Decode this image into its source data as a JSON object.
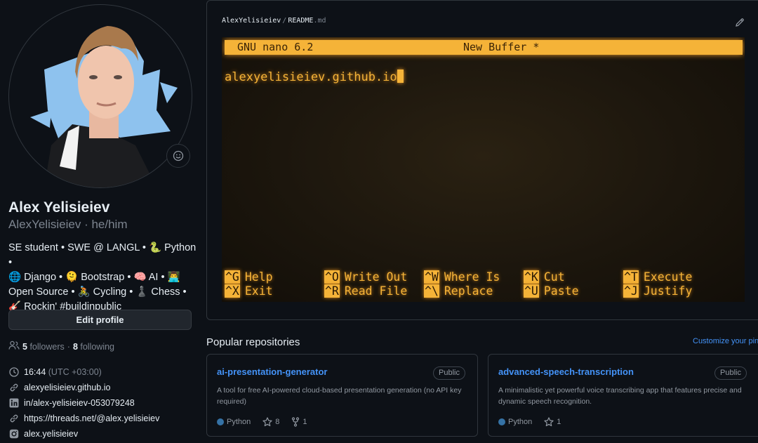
{
  "profile": {
    "name": "Alex Yelisieiev",
    "login": "AlexYelisieiev",
    "pronouns": "he/him",
    "bio_lines": [
      "SE student • SWE @ LANGL • 🐍 Python •",
      "🌐 Django • 🫠 Bootstrap • 🧠 AI • 👨‍💻",
      "Open Source • 🚴 Cycling • ♟️ Chess •",
      "🎸 Rockin' #buildinpublic"
    ],
    "edit_button": "Edit profile",
    "followers_count": "5",
    "followers_label": "followers",
    "dot": "·",
    "following_count": "8",
    "following_label": "following",
    "local_time": "16:44",
    "timezone": "(UTC +03:00)",
    "website": "alexyelisieiev.github.io",
    "linkedin": "in/alex-yelisieiev-053079248",
    "threads": "https://threads.net/@alex.yelisieiev",
    "instagram": "alex.yelisieiev"
  },
  "readme": {
    "owner": "AlexYelisieiev",
    "separator": "/",
    "file_name": "README",
    "file_ext": ".md",
    "terminal": {
      "title_left": "GNU nano 6.2",
      "title_mid": "New Buffer *",
      "content": "alexyelisieiev.github.io",
      "shortcuts": [
        {
          "key": "^G",
          "label": "Help"
        },
        {
          "key": "^O",
          "label": "Write Out"
        },
        {
          "key": "^W",
          "label": "Where Is"
        },
        {
          "key": "^K",
          "label": "Cut"
        },
        {
          "key": "^T",
          "label": "Execute"
        },
        {
          "key": "^X",
          "label": "Exit"
        },
        {
          "key": "^R",
          "label": "Read File"
        },
        {
          "key": "^\\",
          "label": "Replace"
        },
        {
          "key": "^U",
          "label": "Paste"
        },
        {
          "key": "^J",
          "label": "Justify"
        }
      ]
    }
  },
  "popular": {
    "title": "Popular repositories",
    "customize": "Customize your pins",
    "repos": [
      {
        "name": "ai-presentation-generator",
        "visibility": "Public",
        "description": "A tool for free AI-powered cloud-based presentation generation (no API key required)",
        "language": "Python",
        "language_color": "#3572A5",
        "stars": "8",
        "forks": "1"
      },
      {
        "name": "advanced-speech-transcription",
        "visibility": "Public",
        "description": "A minimalistic yet powerful voice transcribing app that features precise and dynamic speech recognition.",
        "language": "Python",
        "language_color": "#3572A5",
        "stars": "1"
      }
    ]
  },
  "colors": {
    "background": "#0d1117",
    "link": "#4493f8",
    "terminal_amber": "#f5b338"
  }
}
